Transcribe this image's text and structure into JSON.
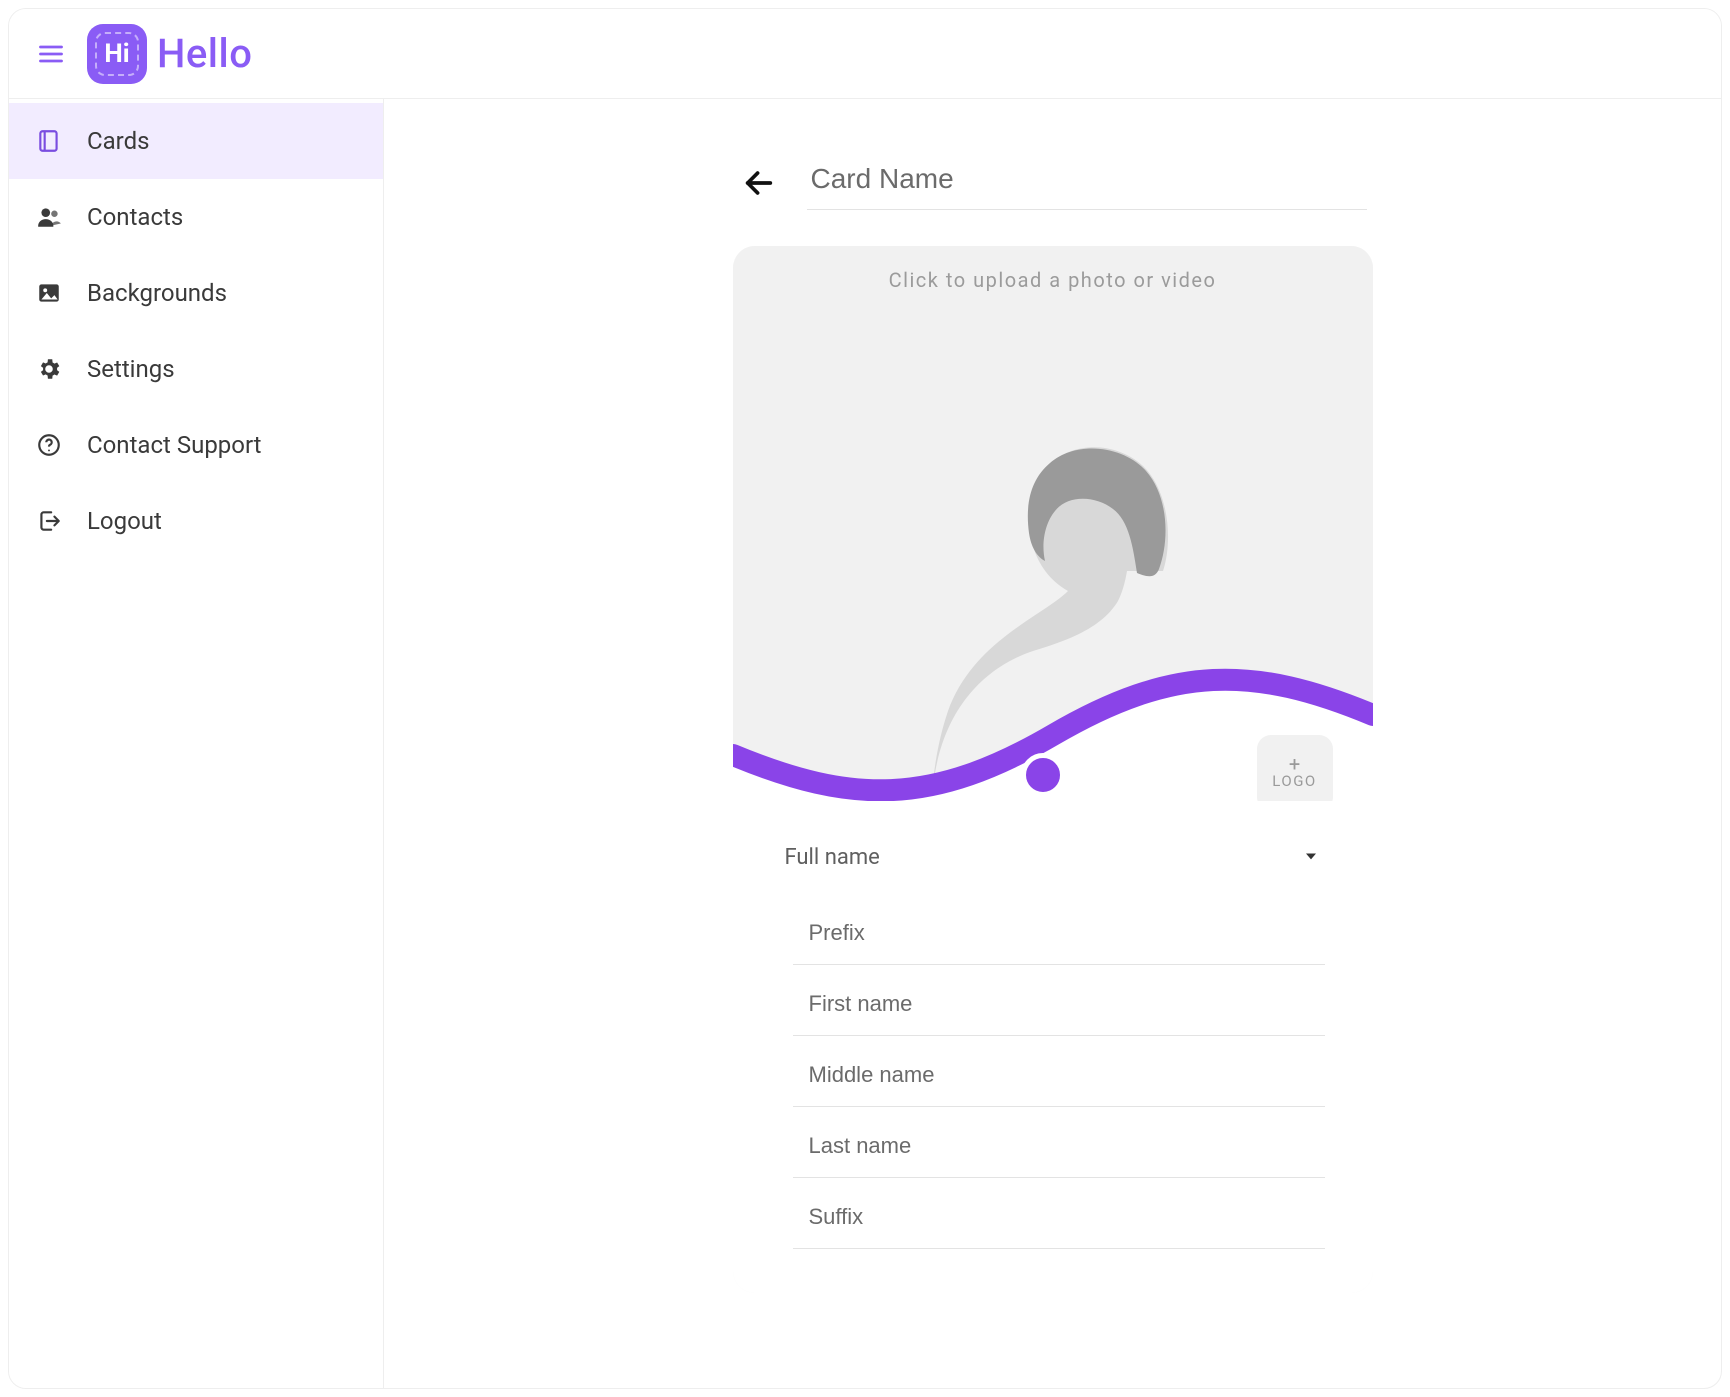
{
  "colors": {
    "brand": "#8a5cf5",
    "accent": "#8a44e8"
  },
  "brand": {
    "badge_text": "Hi",
    "name": "Hello"
  },
  "sidebar": {
    "items": [
      {
        "label": "Cards",
        "icon": "card-icon",
        "active": true
      },
      {
        "label": "Contacts",
        "icon": "contacts-icon",
        "active": false
      },
      {
        "label": "Backgrounds",
        "icon": "backgrounds-icon",
        "active": false
      },
      {
        "label": "Settings",
        "icon": "settings-icon",
        "active": false
      },
      {
        "label": "Contact Support",
        "icon": "help-icon",
        "active": false
      },
      {
        "label": "Logout",
        "icon": "logout-icon",
        "active": false
      }
    ]
  },
  "editor": {
    "card_name_placeholder": "Card Name",
    "card_name_value": "",
    "upload_hint": "Click to upload a photo or video",
    "logo_chip": {
      "plus": "+",
      "label": "LOGO"
    },
    "fullname_label": "Full name",
    "fields": {
      "prefix": {
        "placeholder": "Prefix",
        "value": ""
      },
      "first": {
        "placeholder": "First name",
        "value": ""
      },
      "middle": {
        "placeholder": "Middle name",
        "value": ""
      },
      "last": {
        "placeholder": "Last name",
        "value": ""
      },
      "suffix": {
        "placeholder": "Suffix",
        "value": ""
      }
    }
  }
}
